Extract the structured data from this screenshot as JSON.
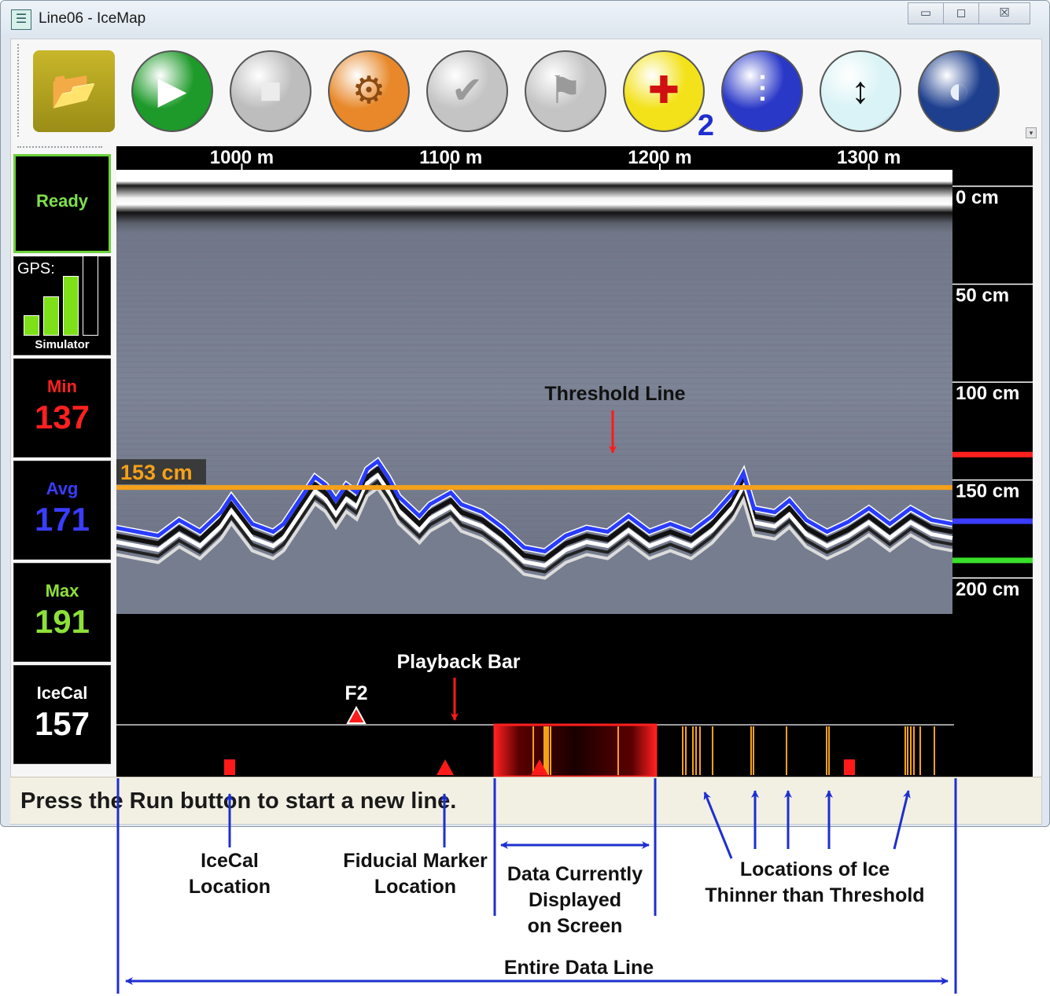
{
  "window": {
    "title": "Line06 - IceMap",
    "controls": {
      "minimize": "▭",
      "maximize": "◻",
      "close": "☒"
    }
  },
  "toolbar": {
    "buttons": [
      {
        "id": "open",
        "icon": "folder-open-icon",
        "color": "#9a8d16"
      },
      {
        "id": "run",
        "icon": "play-icon",
        "color": "#1e9a2a"
      },
      {
        "id": "stop",
        "icon": "stop-icon",
        "color": "#bdbdbd"
      },
      {
        "id": "settings",
        "icon": "gears-icon",
        "color": "#e8882a"
      },
      {
        "id": "calibrate",
        "icon": "ruler-check-icon",
        "color": "#c4c4c4"
      },
      {
        "id": "fiducial",
        "icon": "flag-icon",
        "color": "#c4c4c4"
      },
      {
        "id": "gain",
        "icon": "gain-icon",
        "color": "#f3e21a",
        "badge": "2"
      },
      {
        "id": "filters",
        "icon": "sliders-icon",
        "color": "#2a38c8"
      },
      {
        "id": "depth",
        "icon": "depth-signal-icon",
        "color": "#d9f3f6"
      },
      {
        "id": "globe",
        "icon": "globe-icon",
        "color": "#1e3f8e"
      }
    ]
  },
  "panels": {
    "status": "Ready",
    "gps_label": "GPS:",
    "gps_mode": "Simulator",
    "gps_signal_bars": 4,
    "gps_signal_active": 3,
    "min_label": "Min",
    "min_value": "137",
    "avg_label": "Avg",
    "avg_value": "171",
    "max_label": "Max",
    "max_value": "191",
    "icecal_label": "IceCal",
    "icecal_value": "157",
    "colors": {
      "status": "#7ee04e",
      "min": "#ff2020",
      "avg": "#3a3cff",
      "max": "#8ee03a",
      "icecal": "#ffffff"
    }
  },
  "radar": {
    "distance_ticks": [
      "1000 m",
      "1100 m",
      "1200 m",
      "1300 m"
    ],
    "distance_values": [
      1000,
      1100,
      1200,
      1300
    ],
    "distance_range": [
      940,
      1340
    ],
    "depth_ticks": [
      "0 cm",
      "50 cm",
      "100 cm",
      "150 cm",
      "200 cm"
    ],
    "depth_values": [
      0,
      50,
      100,
      150,
      200
    ],
    "depth_range": [
      -10,
      230
    ],
    "threshold_cm": 153,
    "threshold_label": "153 cm",
    "legend_line_colors": [
      "#ff2020",
      "#3a3cff",
      "#39e02a"
    ],
    "threshold_color": "#f5a11a",
    "trace_color": "#2a3cff"
  },
  "playback": {
    "fiducial_label": "F2",
    "position_fraction": 0.56
  },
  "status_bar": "Press the Run button to start a new line.",
  "annotations": {
    "threshold_line": "Threshold Line",
    "playback_bar": "Playback Bar",
    "icecal_location": [
      "IceCal",
      "Location"
    ],
    "fiducial_location": [
      "Fiducial Marker",
      "Location"
    ],
    "data_displayed": [
      "Data Currently",
      "Displayed",
      "on Screen"
    ],
    "thin_ice": [
      "Locations of Ice",
      "Thinner than Threshold"
    ],
    "entire_line": "Entire Data Line"
  }
}
